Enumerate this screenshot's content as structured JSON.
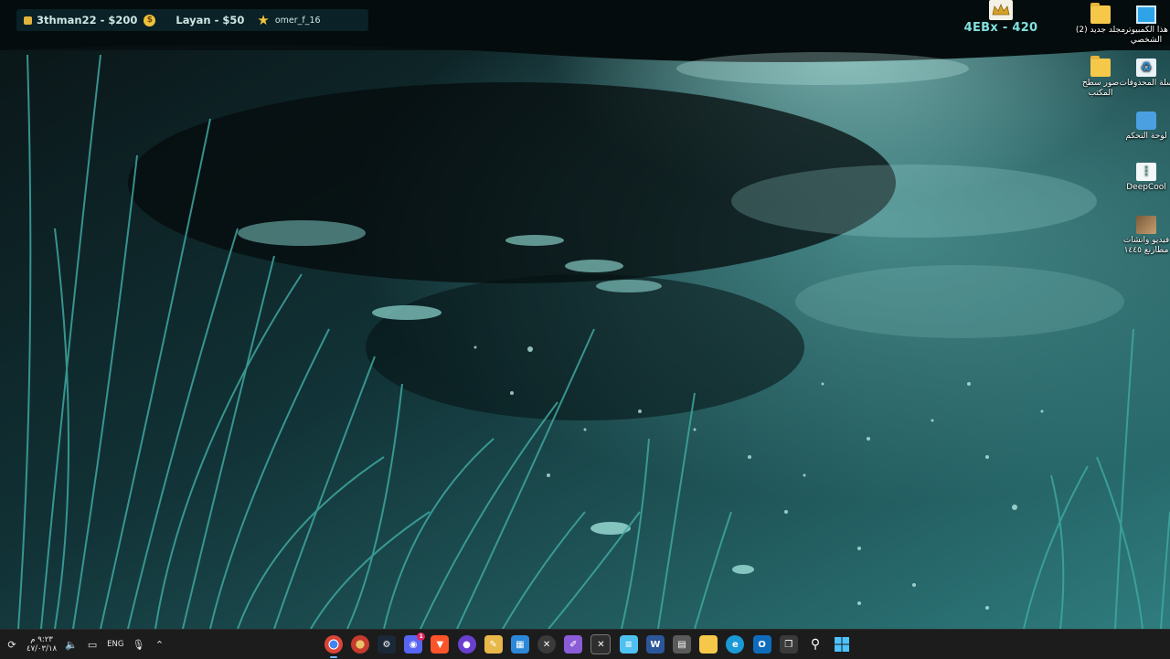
{
  "topbar": {
    "entries": [
      {
        "name": "3thman22 - $200",
        "icon": "gold-coin-icon"
      },
      {
        "name": "Layan - $50",
        "icon": "dollar-coin-icon"
      },
      {
        "name": "omer_f_16",
        "icon": "star-icon"
      }
    ]
  },
  "player": {
    "label": "4EBx - 420",
    "icon": "crown-icon"
  },
  "desktop_icons": [
    {
      "label": "هذا الكمبيوتر الشخصي",
      "icon": "monitor-icon"
    },
    {
      "label": "مجلد جديد (2)",
      "icon": "folder-icon"
    },
    {
      "label": "سلة المحذوفات",
      "icon": "recycle-bin-icon"
    },
    {
      "label": "صور سطح المكتب",
      "icon": "folder-icon"
    },
    {
      "label": "لوحة التحكم",
      "icon": "control-panel-icon"
    },
    {
      "label": "DeepCool",
      "icon": "deepcool-icon"
    },
    {
      "label": "فيديو وانشات مطارنع ١٤٤٥",
      "icon": "photo-icon"
    }
  ],
  "taskbar": {
    "clock_time": "٩:٢٣ م",
    "clock_date": "٤٧/٠٣/١٨",
    "language": "ENG",
    "tray_icons": [
      "network-icon",
      "battery-icon",
      "volume-icon",
      "microphone-icon",
      "chevron-up-icon"
    ],
    "apps": [
      {
        "name": "chrome-icon",
        "color": "#db4437"
      },
      {
        "name": "chrome-dev-icon",
        "color": "#c73a2e"
      },
      {
        "name": "steam-icon",
        "color": "#1b2838"
      },
      {
        "name": "discord-icon",
        "color": "#5865f2",
        "badge": "1"
      },
      {
        "name": "brave-icon",
        "color": "#fb542b"
      },
      {
        "name": "app-purple-icon",
        "color": "#6a3fd0"
      },
      {
        "name": "feather-icon",
        "color": "#e9b84a"
      },
      {
        "name": "microsoft-store-icon",
        "color": "#2b88d8"
      },
      {
        "name": "xbox-icon",
        "color": "#3a3a3a"
      },
      {
        "name": "pen-icon",
        "color": "#8a5cd8"
      },
      {
        "name": "xbox-game-bar-icon",
        "color": "#2e2e2e"
      },
      {
        "name": "notepad-icon",
        "color": "#4ec1f0"
      },
      {
        "name": "word-icon",
        "color": "#2b579a"
      },
      {
        "name": "calculator-icon",
        "color": "#5a5a5a"
      },
      {
        "name": "file-explorer-icon",
        "color": "#f6c84a"
      },
      {
        "name": "edge-icon",
        "color": "#1a9ad6"
      },
      {
        "name": "outlook-icon",
        "color": "#0f6cbd"
      },
      {
        "name": "task-view-icon",
        "color": "#3a3a3a"
      },
      {
        "name": "search-icon",
        "color": "#1c1c1c"
      },
      {
        "name": "start-icon",
        "color": "#1c1c1c"
      }
    ]
  }
}
